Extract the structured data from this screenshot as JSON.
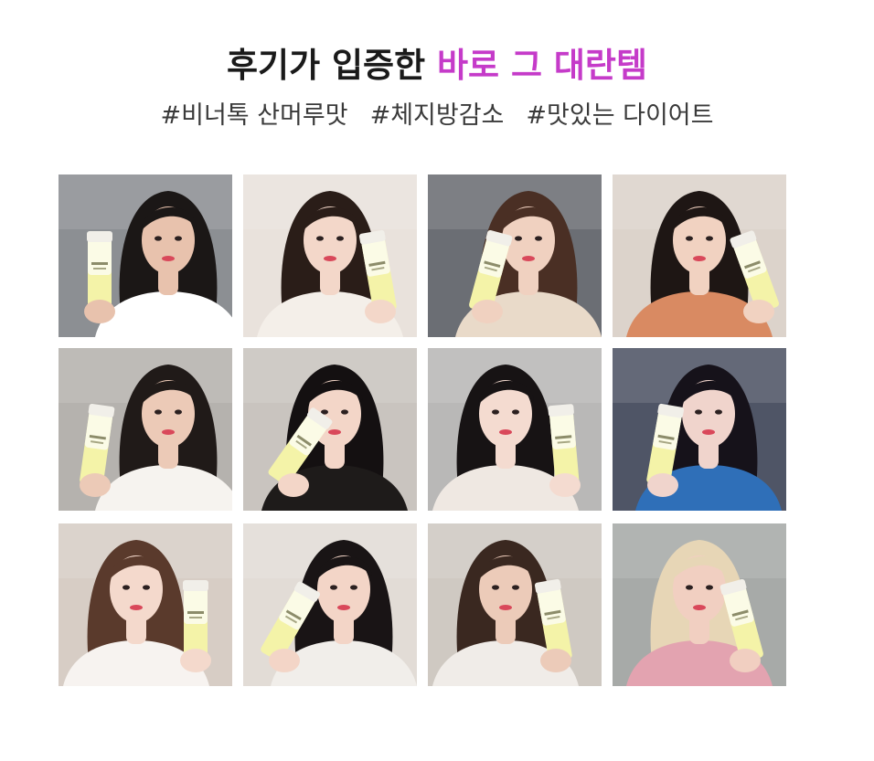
{
  "header": {
    "title_prefix": "후기가 입증한 ",
    "title_highlight": "바로 그 대란템",
    "highlight_color": "#c53bc9"
  },
  "hashtags": [
    "#비너톡 산머루맛",
    "#체지방감소",
    "#맛있는 다이어트"
  ],
  "gallery": {
    "photos": [
      {
        "bg": "#8c8f93",
        "hair": "#1b1716",
        "skin": "#e8c2ad",
        "top": "#ffffff"
      },
      {
        "bg": "#e9e2dc",
        "hair": "#2a1d18",
        "skin": "#f3d7c9",
        "top": "#f4efe9"
      },
      {
        "bg": "#6b6e74",
        "hair": "#4a2f24",
        "skin": "#f0d1c0",
        "top": "#e9dac9"
      },
      {
        "bg": "#dcd3cb",
        "hair": "#1e1614",
        "skin": "#f1d2c1",
        "top": "#d98a62"
      },
      {
        "bg": "#b5b2ae",
        "hair": "#201a18",
        "skin": "#eccab7",
        "top": "#f6f3ef"
      },
      {
        "bg": "#c9c4bf",
        "hair": "#141011",
        "skin": "#f3d6c8",
        "top": "#1e1b1a"
      },
      {
        "bg": "#b9b8b7",
        "hair": "#171314",
        "skin": "#f4dbd0",
        "top": "#efe8e2"
      },
      {
        "bg": "#4f5566",
        "hair": "#16121a",
        "skin": "#f0d4cc",
        "top": "#2f6fb8"
      },
      {
        "bg": "#d7cdc5",
        "hair": "#5a3a2c",
        "skin": "#f4d9cc",
        "top": "#f7f3f0"
      },
      {
        "bg": "#e2dcd6",
        "hair": "#191415",
        "skin": "#f3d5c7",
        "top": "#f1eeea"
      },
      {
        "bg": "#cfc9c2",
        "hair": "#3a2820",
        "skin": "#eccbb9",
        "top": "#f0ece8"
      },
      {
        "bg": "#a7aaa8",
        "hair": "#e7d6b6",
        "skin": "#f1cfc1",
        "top": "#e3a3b0"
      }
    ]
  }
}
